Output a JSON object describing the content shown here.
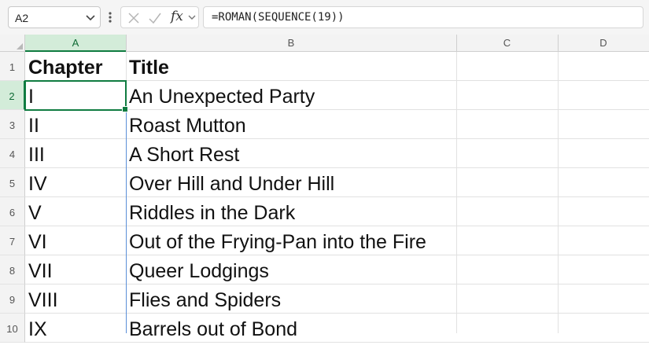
{
  "name_box": {
    "value": "A2"
  },
  "formula_bar": {
    "fx_label": "fx",
    "formula": "=ROMAN(SEQUENCE(19))"
  },
  "columns": [
    "A",
    "B",
    "C",
    "D"
  ],
  "selected_column": "A",
  "selected_row": "2",
  "rows": [
    {
      "num": "1",
      "a": "Chapter",
      "b": "Title",
      "bold": true
    },
    {
      "num": "2",
      "a": "I",
      "b": "An Unexpected Party"
    },
    {
      "num": "3",
      "a": "II",
      "b": "Roast Mutton"
    },
    {
      "num": "4",
      "a": "III",
      "b": "A Short Rest"
    },
    {
      "num": "5",
      "a": "IV",
      "b": "Over Hill and Under Hill"
    },
    {
      "num": "6",
      "a": "V",
      "b": "Riddles in the Dark"
    },
    {
      "num": "7",
      "a": "VI",
      "b": "Out of the Frying-Pan into the Fire"
    },
    {
      "num": "8",
      "a": "VII",
      "b": "Queer Lodgings"
    },
    {
      "num": "9",
      "a": "VIII",
      "b": "Flies and Spiders"
    },
    {
      "num": "10",
      "a": "IX",
      "b": "Barrels out of Bond"
    }
  ],
  "colors": {
    "accent": "#107c41",
    "spill_border": "#5b8fd8",
    "header_bg": "#f3f3f3"
  },
  "icons": [
    "chevron-down-icon",
    "more-vertical-icon",
    "cancel-x-icon",
    "enter-check-icon",
    "insert-function-icon"
  ]
}
